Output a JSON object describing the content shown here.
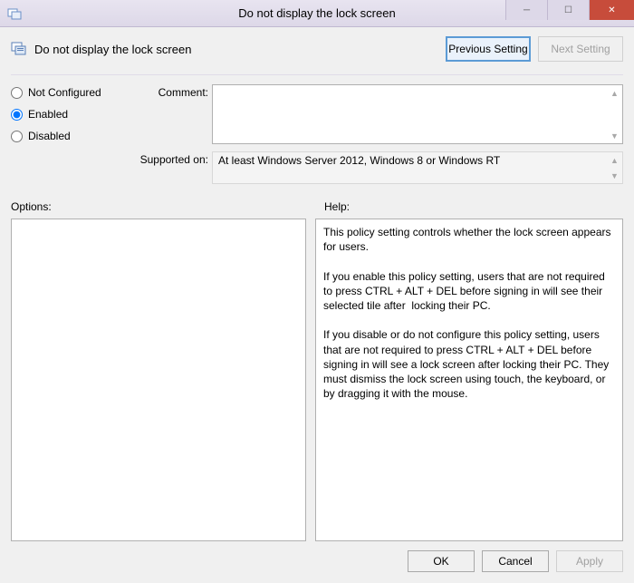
{
  "window": {
    "title": "Do not display the lock screen"
  },
  "header": {
    "title": "Do not display the lock screen"
  },
  "nav": {
    "previous": "Previous Setting",
    "next": "Next Setting"
  },
  "radios": {
    "not_configured": "Not Configured",
    "enabled": "Enabled",
    "disabled": "Disabled",
    "selected": "enabled"
  },
  "fields": {
    "comment_label": "Comment:",
    "comment_value": "",
    "supported_label": "Supported on:",
    "supported_value": "At least Windows Server 2012, Windows 8 or Windows RT"
  },
  "panes": {
    "options_label": "Options:",
    "help_label": "Help:",
    "help_text": "This policy setting controls whether the lock screen appears for users.\n\nIf you enable this policy setting, users that are not required to press CTRL + ALT + DEL before signing in will see their selected tile after  locking their PC.\n\nIf you disable or do not configure this policy setting, users that are not required to press CTRL + ALT + DEL before signing in will see a lock screen after locking their PC. They must dismiss the lock screen using touch, the keyboard, or by dragging it with the mouse."
  },
  "footer": {
    "ok": "OK",
    "cancel": "Cancel",
    "apply": "Apply"
  }
}
